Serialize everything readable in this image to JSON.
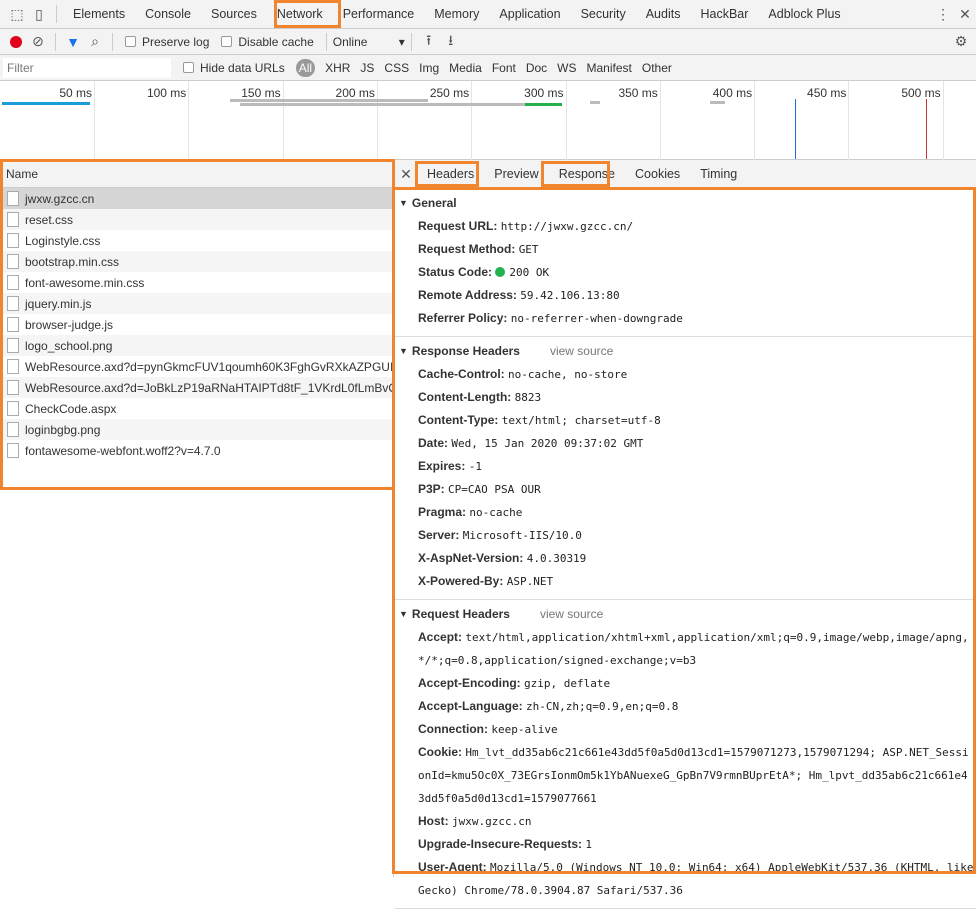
{
  "tabs": [
    "Elements",
    "Console",
    "Sources",
    "Network",
    "Performance",
    "Memory",
    "Application",
    "Security",
    "Audits",
    "HackBar",
    "Adblock Plus"
  ],
  "toolbar": {
    "preserve_log": "Preserve log",
    "disable_cache": "Disable cache",
    "throttle": "Online"
  },
  "filter": {
    "placeholder": "Filter",
    "hide_data_urls": "Hide data URLs",
    "types": [
      "All",
      "XHR",
      "JS",
      "CSS",
      "Img",
      "Media",
      "Font",
      "Doc",
      "WS",
      "Manifest",
      "Other"
    ]
  },
  "timeline": {
    "ticks": [
      "50 ms",
      "100 ms",
      "150 ms",
      "200 ms",
      "250 ms",
      "300 ms",
      "350 ms",
      "400 ms",
      "450 ms",
      "500 ms"
    ]
  },
  "requests": {
    "header": "Name",
    "items": [
      "jwxw.gzcc.cn",
      "reset.css",
      "Loginstyle.css",
      "bootstrap.min.css",
      "font-awesome.min.css",
      "jquery.min.js",
      "browser-judge.js",
      "logo_school.png",
      "WebResource.axd?d=pynGkmcFUV1qoumh60K3FghGvRXkAZPGUI...",
      "WebResource.axd?d=JoBkLzP19aRNaHTAIPTd8tF_1VKrdL0fLmBvOT...",
      "CheckCode.aspx",
      "loginbgbg.png",
      "fontawesome-webfont.woff2?v=4.7.0"
    ]
  },
  "detail_tabs": [
    "Headers",
    "Preview",
    "Response",
    "Cookies",
    "Timing"
  ],
  "general": {
    "title": "General",
    "items": [
      [
        "Request URL:",
        "http://jwxw.gzcc.cn/"
      ],
      [
        "Request Method:",
        "GET"
      ],
      [
        "Status Code:",
        "200 OK"
      ],
      [
        "Remote Address:",
        "59.42.106.13:80"
      ],
      [
        "Referrer Policy:",
        "no-referrer-when-downgrade"
      ]
    ]
  },
  "response_headers": {
    "title": "Response Headers",
    "view_source": "view source",
    "items": [
      [
        "Cache-Control:",
        "no-cache, no-store"
      ],
      [
        "Content-Length:",
        "8823"
      ],
      [
        "Content-Type:",
        "text/html; charset=utf-8"
      ],
      [
        "Date:",
        "Wed, 15 Jan 2020 09:37:02 GMT"
      ],
      [
        "Expires:",
        "-1"
      ],
      [
        "P3P:",
        "CP=CAO PSA OUR"
      ],
      [
        "Pragma:",
        "no-cache"
      ],
      [
        "Server:",
        "Microsoft-IIS/10.0"
      ],
      [
        "X-AspNet-Version:",
        "4.0.30319"
      ],
      [
        "X-Powered-By:",
        "ASP.NET"
      ]
    ]
  },
  "request_headers": {
    "title": "Request Headers",
    "view_source": "view source",
    "items": [
      [
        "Accept:",
        "text/html,application/xhtml+xml,application/xml;q=0.9,image/webp,image/apng,*/*;q=0.8,application/signed-exchange;v=b3"
      ],
      [
        "Accept-Encoding:",
        "gzip, deflate"
      ],
      [
        "Accept-Language:",
        "zh-CN,zh;q=0.9,en;q=0.8"
      ],
      [
        "Connection:",
        "keep-alive"
      ],
      [
        "Cookie:",
        "Hm_lvt_dd35ab6c21c661e43dd5f0a5d0d13cd1=1579071273,1579071294; ASP.NET_SessionId=kmu5Oc0X_73EGrsIonmOm5k1YbANuexeG_GpBn7V9rmnBUprEtA*; Hm_lpvt_dd35ab6c21c661e43dd5f0a5d0d13cd1=1579077661"
      ],
      [
        "Host:",
        "jwxw.gzcc.cn"
      ],
      [
        "Upgrade-Insecure-Requests:",
        "1"
      ],
      [
        "User-Agent:",
        "Mozilla/5.0 (Windows NT 10.0; Win64; x64) AppleWebKit/537.36 (KHTML, like Gecko) Chrome/78.0.3904.87 Safari/537.36"
      ]
    ]
  },
  "colors": {
    "highlight": "#f0852d",
    "record": "#e0001b",
    "status_ok": "#22b14c",
    "filter_icon": "#1a73e8"
  }
}
